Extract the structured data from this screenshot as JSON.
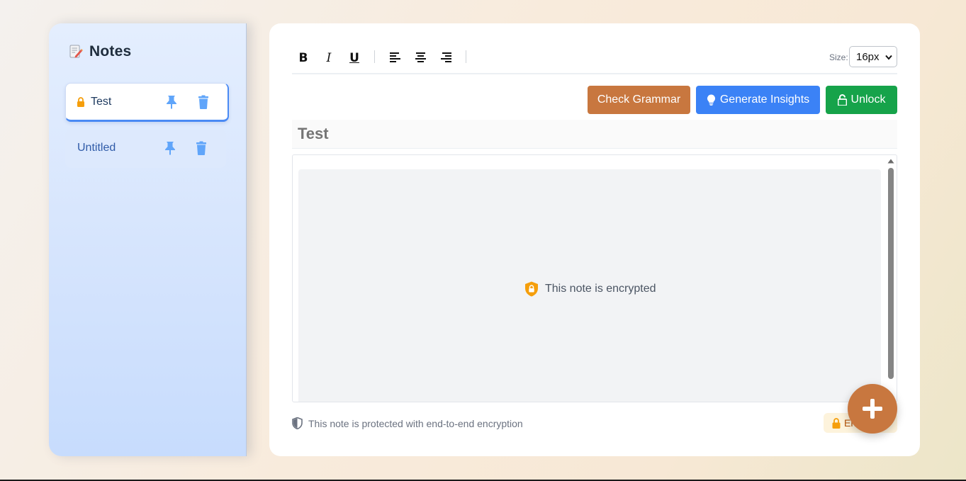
{
  "sidebar": {
    "title": "Notes",
    "logo_icon": "notes-logo-icon",
    "notes": [
      {
        "label": "Test",
        "locked": true,
        "active": true
      },
      {
        "label": "Untitled",
        "locked": false,
        "active": false
      }
    ]
  },
  "toolbar": {
    "bold": "B",
    "italic": "I",
    "underline": "U",
    "size_label": "Size:",
    "size_value": "16px"
  },
  "actions": {
    "grammar_label": "Check Grammar",
    "insights_label": "Generate Insights",
    "unlock_label": "Unlock"
  },
  "editor": {
    "title": "Test",
    "encrypted_message": "This note is encrypted"
  },
  "footer": {
    "protection_text": "This note is protected with end-to-end encryption",
    "badge_text": "Encrypted"
  },
  "colors": {
    "accent_orange": "#c8773f",
    "insights_blue": "#3b82f6",
    "unlock_green": "#16a34a",
    "lock_amber": "#f59e0b"
  }
}
